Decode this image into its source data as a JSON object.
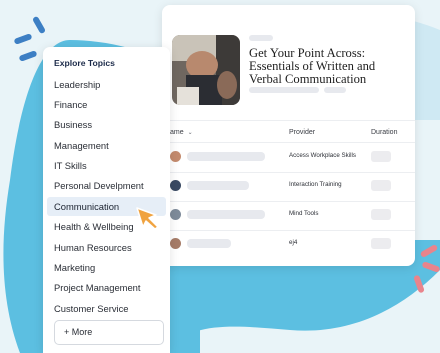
{
  "menu": {
    "title": "Explore Topics",
    "items": [
      {
        "label": "Leadership"
      },
      {
        "label": "Finance"
      },
      {
        "label": "Business"
      },
      {
        "label": "Management"
      },
      {
        "label": "IT Skills"
      },
      {
        "label": "Personal Develpment"
      },
      {
        "label": "Communication"
      },
      {
        "label": "Health & Wellbeing"
      },
      {
        "label": "Human Resources"
      },
      {
        "label": "Marketing"
      },
      {
        "label": "Project Management"
      },
      {
        "label": "Customer Service"
      }
    ],
    "more_label": "+ More"
  },
  "course": {
    "title": "Get Your Point Across: Essentials of Written and Verbal Communication"
  },
  "table": {
    "columns": {
      "name": "ame",
      "provider": "Provider",
      "duration": "Duration"
    },
    "rows": [
      {
        "provider": "Access Workplace Skills"
      },
      {
        "provider": "Interaction Training"
      },
      {
        "provider": "Mind Tools"
      },
      {
        "provider": "ej4"
      }
    ]
  },
  "colors": {
    "blob_blue": "#5cbfe1",
    "accent_dash_blue": "#3d7fc4",
    "accent_dash_coral": "#e9848c",
    "cursor": "#f0a340"
  }
}
